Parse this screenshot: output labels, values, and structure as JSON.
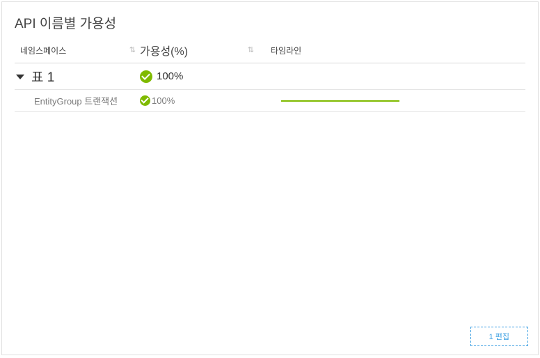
{
  "title": "API 이름별 가용성",
  "columns": {
    "namespace": "네임스페이스",
    "availability": "가용성(%)",
    "timeline": "타임라인"
  },
  "rows": [
    {
      "label": "표 1",
      "availability": "100%",
      "expanded": true,
      "children": [
        {
          "label": "EntityGroup 트랜잭션",
          "availability": "100%"
        }
      ]
    }
  ],
  "footer": {
    "edit_label": "1 편집"
  },
  "colors": {
    "success": "#7FBA00",
    "link": "#3b9fe2"
  }
}
